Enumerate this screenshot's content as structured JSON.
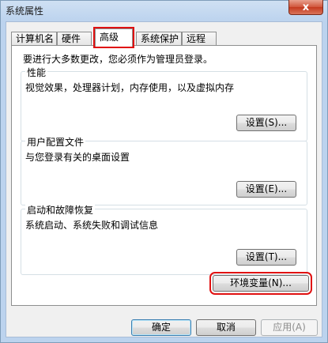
{
  "window": {
    "title": "系统属性",
    "close_glyph": "x"
  },
  "tabs": [
    {
      "label": "计算机名"
    },
    {
      "label": "硬件"
    },
    {
      "label": "高级"
    },
    {
      "label": "系统保护"
    },
    {
      "label": "远程"
    }
  ],
  "active_tab": "高级",
  "advanced": {
    "intro": "要进行大多数更改，您必须作为管理员登录。",
    "performance": {
      "title": "性能",
      "description": "视觉效果，处理器计划，内存使用，以及虚拟内存",
      "button": "设置(S)..."
    },
    "user_profiles": {
      "title": "用户配置文件",
      "description": "与您登录有关的桌面设置",
      "button": "设置(E)..."
    },
    "startup_recovery": {
      "title": "启动和故障恢复",
      "description": "系统启动、系统失败和调试信息",
      "button": "设置(T)..."
    },
    "env_button": "环境变量(N)..."
  },
  "footer": {
    "ok": "确定",
    "cancel": "取消",
    "apply": "应用(A)"
  }
}
